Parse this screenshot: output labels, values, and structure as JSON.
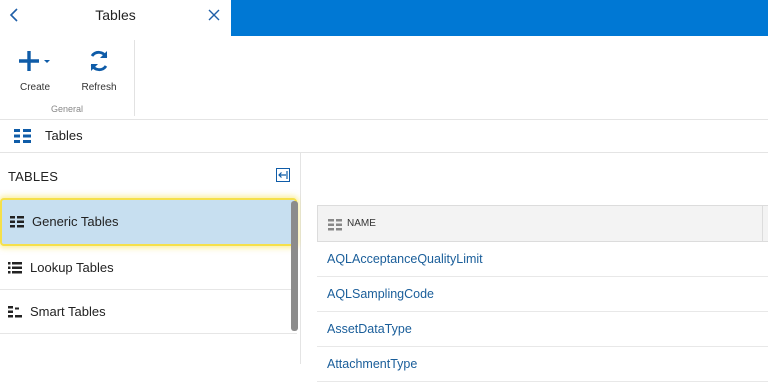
{
  "header": {
    "title": "Tables",
    "accent_color": "#0078d4"
  },
  "ribbon": {
    "buttons": [
      {
        "label": "Create",
        "icon": "plus-icon"
      },
      {
        "label": "Refresh",
        "icon": "refresh-icon"
      }
    ],
    "group_label": "General"
  },
  "breadcrumb": {
    "label": "Tables",
    "icon": "table-grid-icon"
  },
  "left_panel": {
    "title": "TABLES",
    "items": [
      {
        "label": "Generic Tables",
        "icon": "generic-table-icon",
        "selected": true
      },
      {
        "label": "Lookup Tables",
        "icon": "lookup-list-icon",
        "selected": false
      },
      {
        "label": "Smart Tables",
        "icon": "smart-table-icon",
        "selected": false
      }
    ]
  },
  "grid": {
    "column_header": "NAME",
    "rows": [
      "AQLAcceptanceQualityLimit",
      "AQLSamplingCode",
      "AssetDataType",
      "AttachmentType"
    ]
  }
}
